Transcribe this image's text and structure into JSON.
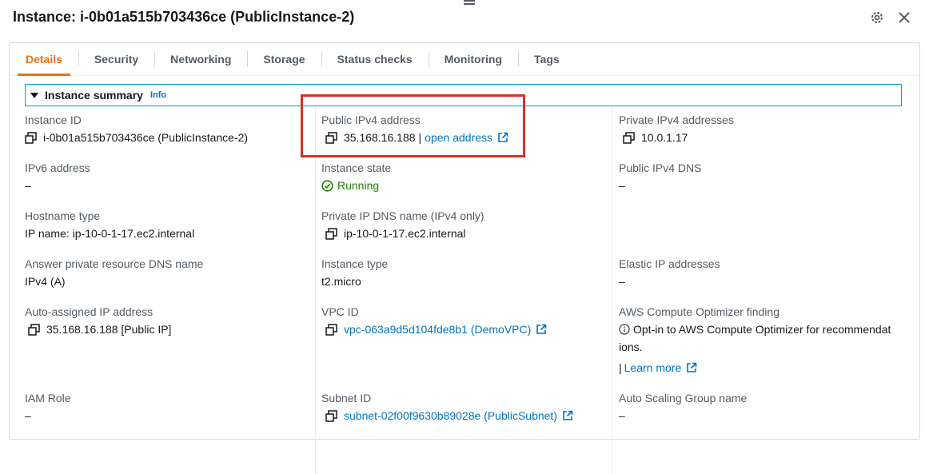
{
  "title": "Instance: i-0b01a515b703436ce (PublicInstance-2)",
  "tabs": [
    "Details",
    "Security",
    "Networking",
    "Storage",
    "Status checks",
    "Monitoring",
    "Tags"
  ],
  "summary": {
    "title": "Instance summary",
    "info": "Info"
  },
  "col1": {
    "instance_id": {
      "label": "Instance ID",
      "value": "i-0b01a515b703436ce (PublicInstance-2)"
    },
    "ipv6": {
      "label": "IPv6 address",
      "value": "–"
    },
    "hostname_type": {
      "label": "Hostname type",
      "value": "IP name: ip-10-0-1-17.ec2.internal"
    },
    "answer_dns": {
      "label": "Answer private resource DNS name",
      "value": "IPv4 (A)"
    },
    "auto_ip": {
      "label": "Auto-assigned IP address",
      "value": "35.168.16.188 [Public IP]"
    },
    "iam_role": {
      "label": "IAM Role",
      "value": "–"
    }
  },
  "col2": {
    "public_ipv4": {
      "label": "Public IPv4 address",
      "value": "35.168.16.188",
      "sep": "|",
      "link": "open address"
    },
    "state": {
      "label": "Instance state",
      "value": "Running"
    },
    "private_dns": {
      "label": "Private IP DNS name (IPv4 only)",
      "value": "ip-10-0-1-17.ec2.internal"
    },
    "instance_type": {
      "label": "Instance type",
      "value": "t2.micro"
    },
    "vpc": {
      "label": "VPC ID",
      "value": "vpc-063a9d5d104fde8b1 (DemoVPC)"
    },
    "subnet": {
      "label": "Subnet ID",
      "value": "subnet-02f00f9630b89028e (PublicSubnet)"
    }
  },
  "col3": {
    "private_ipv4": {
      "label": "Private IPv4 addresses",
      "value": "10.0.1.17"
    },
    "public_dns": {
      "label": "Public IPv4 DNS",
      "value": "–"
    },
    "elastic_ip": {
      "label": "Elastic IP addresses",
      "value": "–"
    },
    "optimizer": {
      "label": "AWS Compute Optimizer finding",
      "line1": "Opt-in to AWS Compute Optimizer for recommendat",
      "line2": "ions.",
      "sep": "|",
      "link": "Learn more"
    },
    "asg": {
      "label": "Auto Scaling Group name",
      "value": "–"
    }
  },
  "colors": {
    "accent": "#ec7211",
    "link": "#0073bb",
    "running": "#1d8102",
    "highlight": "#d93025"
  },
  "icons": [
    "drag-handle-icon",
    "settings-icon",
    "close-icon",
    "copy-icon",
    "external-link-icon",
    "check-circle-icon",
    "info-circle-icon",
    "caret-down-icon"
  ]
}
